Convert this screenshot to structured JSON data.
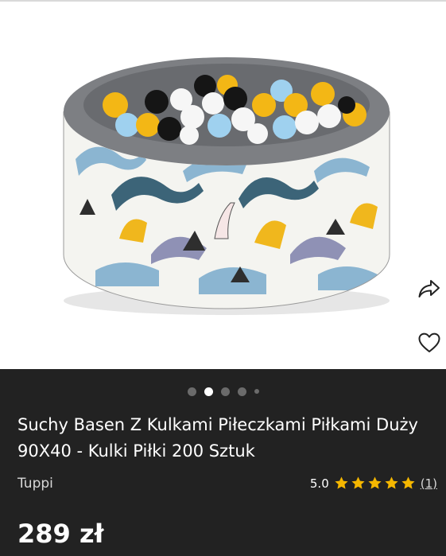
{
  "product": {
    "title": "Suchy Basen Z Kulkami Piłeczkami Piłkami Duży 90X40 - Kulki Piłki 200 Sztuk",
    "seller": "Tuppi",
    "rating": "5.0",
    "rating_stars": 5,
    "review_count": "(1)",
    "price": "289 zł"
  },
  "gallery": {
    "image_count": 5,
    "active_index": 1
  },
  "icons": {
    "share": "share-icon",
    "favorite": "heart-icon",
    "star": "star-icon"
  },
  "colors": {
    "background": "#222222",
    "star": "#f5b700",
    "pool_gray": "#7d7f83",
    "ball_yellow": "#f3b715",
    "ball_blue": "#9fd1ef"
  }
}
